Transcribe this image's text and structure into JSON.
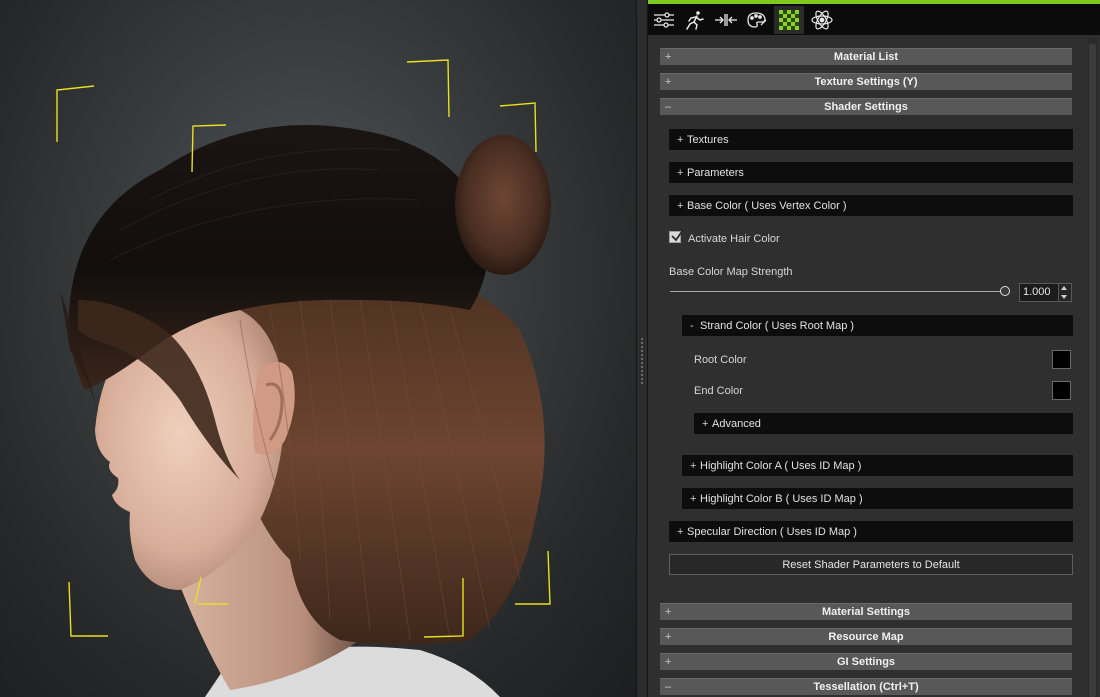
{
  "toolbar": {
    "tabs": [
      {
        "icon": "sliders-icon",
        "active": false
      },
      {
        "icon": "running-figure-icon",
        "active": false
      },
      {
        "icon": "morph-arrows-icon",
        "active": false
      },
      {
        "icon": "palette-icon",
        "active": false
      },
      {
        "icon": "checker-material-icon",
        "active": true
      },
      {
        "icon": "atom-physics-icon",
        "active": false
      }
    ],
    "accent_color": "#7ec91f"
  },
  "sections": {
    "material_list": {
      "label": "Material List",
      "toggle": "+"
    },
    "texture_settings": {
      "label": "Texture Settings  (Y)",
      "toggle": "+"
    },
    "shader_settings": {
      "label": "Shader Settings",
      "toggle": "–"
    },
    "material_settings": {
      "label": "Material Settings",
      "toggle": "+"
    },
    "resource_map": {
      "label": "Resource Map",
      "toggle": "+"
    },
    "gi_settings": {
      "label": "GI Settings",
      "toggle": "+"
    },
    "tessellation": {
      "label": "Tessellation  (Ctrl+T)",
      "toggle": "–"
    }
  },
  "shader": {
    "textures": {
      "label": "Textures",
      "toggle": "+"
    },
    "parameters": {
      "label": "Parameters",
      "toggle": "+"
    },
    "base_color": {
      "label": "Base Color ( Uses Vertex Color )",
      "toggle": "+"
    },
    "activate_hair_color": {
      "label": "Activate Hair Color",
      "checked": true
    },
    "base_color_map_strength": {
      "label": "Base Color Map Strength",
      "value": "1.000",
      "fraction": 1.0
    },
    "strand_color": {
      "label": "Strand Color ( Uses Root Map )",
      "toggle": "-"
    },
    "root_color": {
      "label": "Root Color",
      "color": "#000000"
    },
    "end_color": {
      "label": "End Color",
      "color": "#000000"
    },
    "advanced": {
      "label": "Advanced",
      "toggle": "+"
    },
    "highlight_a": {
      "label": "Highlight Color A ( Uses ID Map )",
      "toggle": "+"
    },
    "highlight_b": {
      "label": "Highlight Color B ( Uses ID Map )",
      "toggle": "+"
    },
    "specular_direction": {
      "label": "Specular Direction ( Uses ID Map )",
      "toggle": "+"
    },
    "reset_button": "Reset Shader Parameters to Default"
  },
  "viewport": {
    "bracket_color": "#e8e020"
  }
}
